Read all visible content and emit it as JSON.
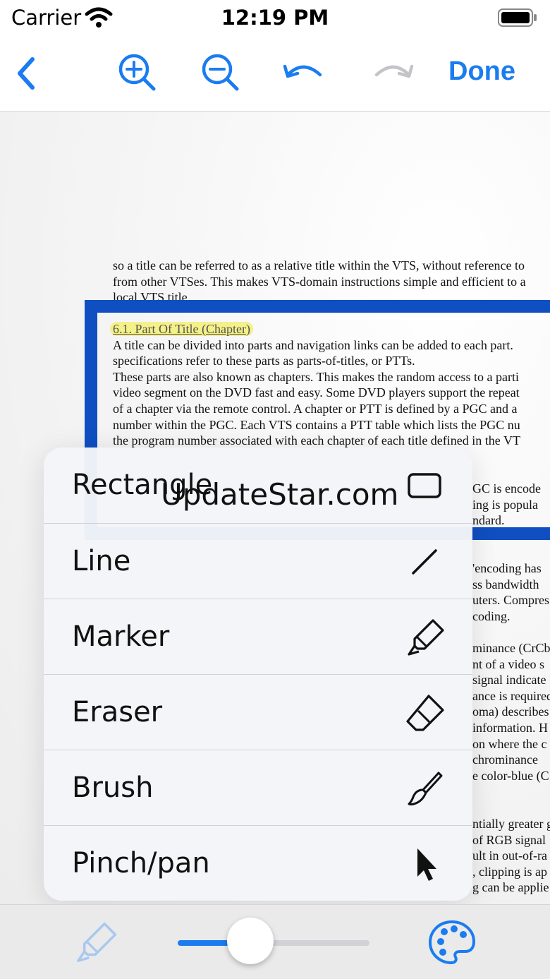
{
  "status_bar": {
    "carrier": "Carrier",
    "time": "12:19 PM"
  },
  "nav_bar": {
    "done_label": "Done"
  },
  "document": {
    "top_lines": [
      "so a title can be referred to as a relative title within the VTS, without reference to",
      "from other VTSes. This makes VTS-domain instructions simple and efficient to a",
      "local VTS title."
    ],
    "heading": "6.1. Part Of Title (Chapter)",
    "body_lines": [
      "A title can be divided into parts and navigation links can be added to each part.",
      "specifications refer to these parts as parts-of-titles, or PTTs.",
      "These parts are also known as chapters. This makes the random access to a parti",
      "video segment on the DVD fast and easy. Some DVD players support the repeat",
      "of a chapter via the remote control. A chapter or PTT is defined by a PGC and a",
      "number within the PGC. Each VTS contains a PTT table which lists the PGC nu",
      "the program number associated with each chapter of each title defined in the VT"
    ],
    "right_fragments_1": [
      "GC is encode",
      "ing is popula",
      "ndard."
    ],
    "right_fragments_2": [
      "'encoding has",
      "ss bandwidth",
      "uters. Compres",
      "coding."
    ],
    "right_fragments_3": [
      "minance (CrCb",
      "nt of a video s",
      "signal indicate",
      "ance is required",
      "oma) describes",
      "information. H",
      "on where the c",
      "chrominance",
      "e color-blue (C"
    ],
    "right_fragments_4": [
      "ntially greater g",
      "of RGB signal",
      "ult in out-of-ra",
      ", clipping is ap",
      "g can be applie"
    ]
  },
  "menu": {
    "items": [
      {
        "label": "Rectangle",
        "icon": "rectangle-icon"
      },
      {
        "label": "Line",
        "icon": "line-icon"
      },
      {
        "label": "Marker",
        "icon": "marker-icon"
      },
      {
        "label": "Eraser",
        "icon": "eraser-icon"
      },
      {
        "label": "Brush",
        "icon": "brush-icon"
      },
      {
        "label": "Pinch/pan",
        "icon": "cursor-arrow-icon"
      }
    ]
  },
  "watermark": "UpdateStar.com",
  "toolbar": {
    "stroke_width_fraction": 0.38
  },
  "colors": {
    "accent": "#1a7cf0",
    "doc_frame": "#0f4fc2",
    "highlight": "#f4f08a"
  }
}
